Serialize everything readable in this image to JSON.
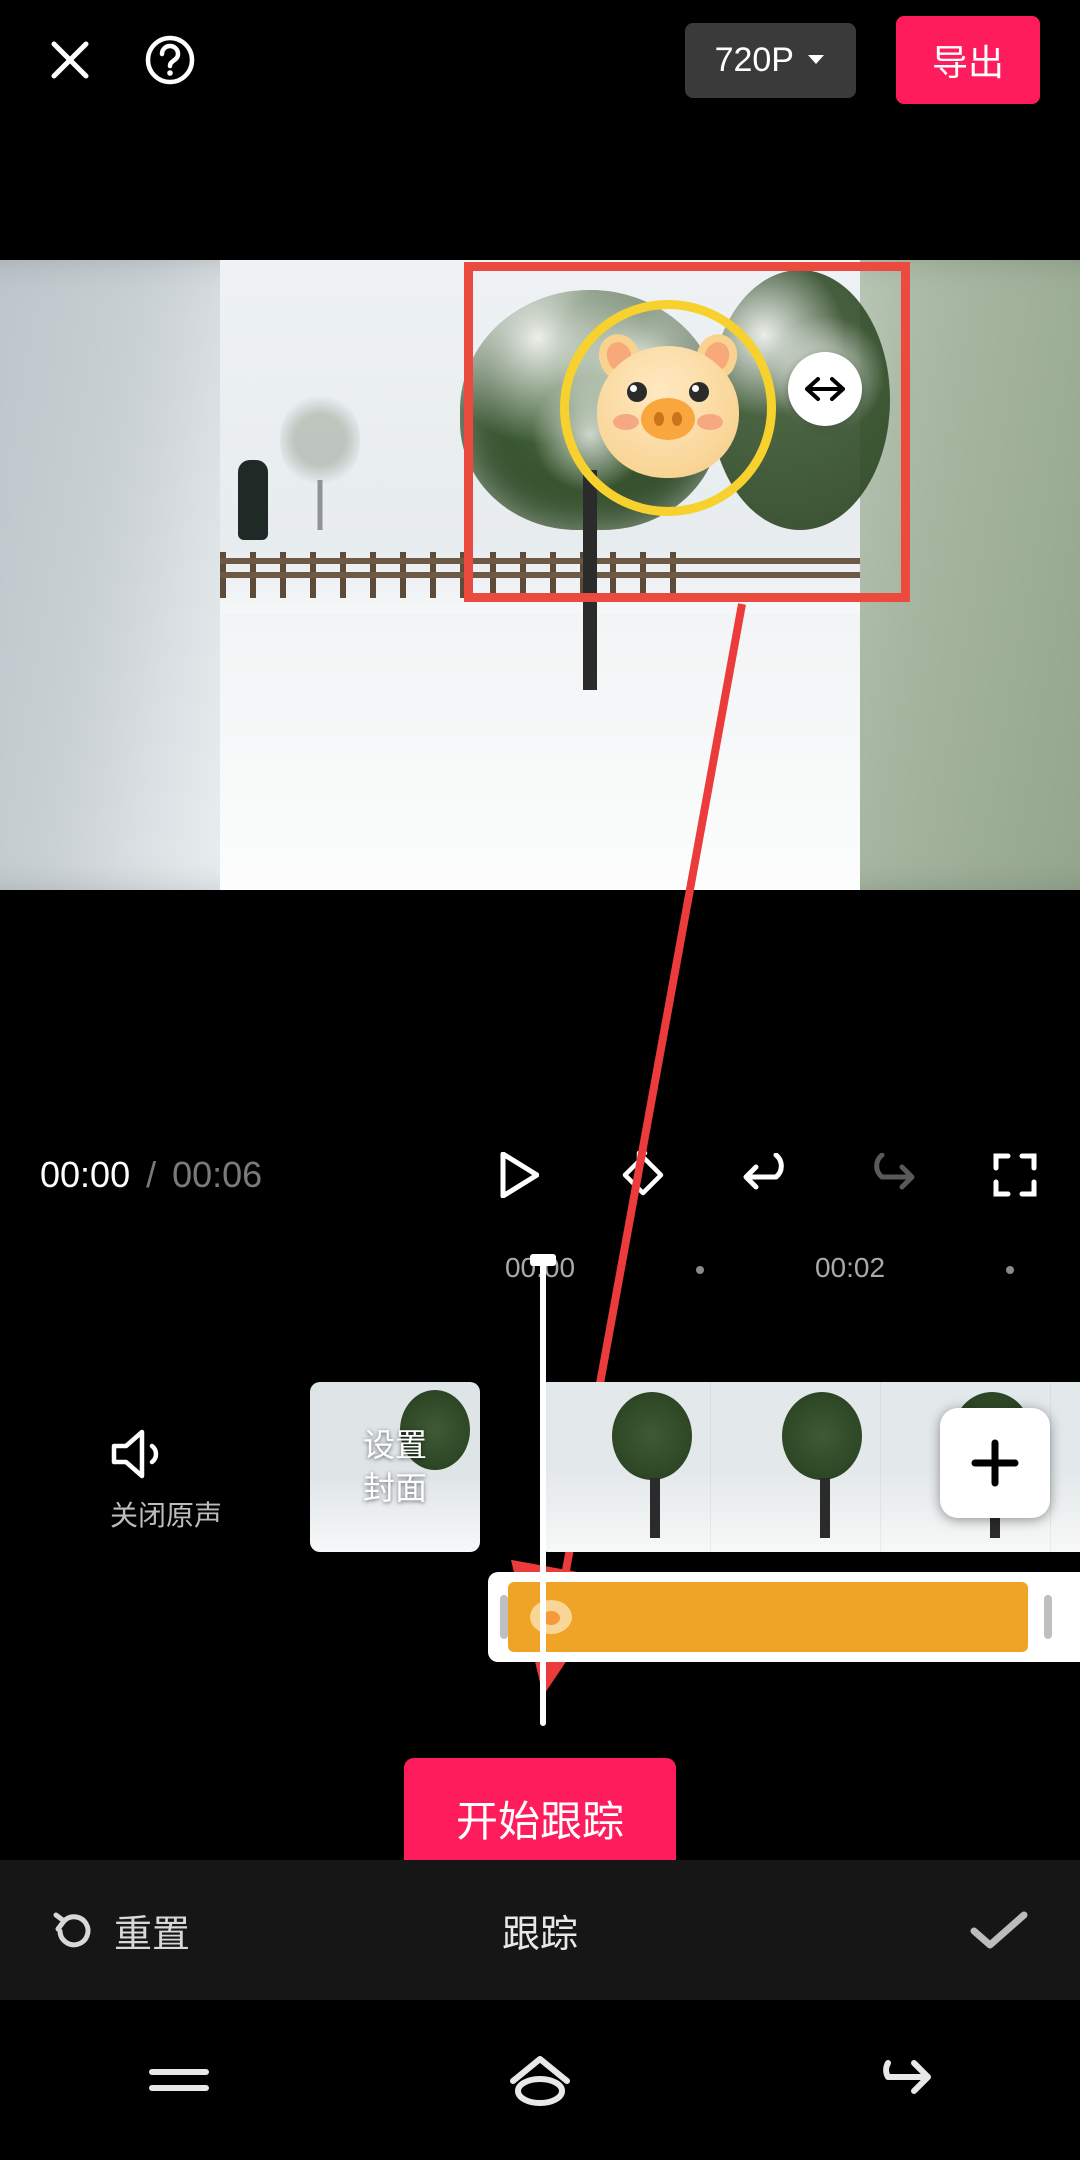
{
  "header": {
    "resolution_label": "720P",
    "export_label": "导出"
  },
  "playback": {
    "current_time": "00:00",
    "separator": "/",
    "duration": "00:06"
  },
  "ruler": {
    "t0": "00:00",
    "t1": "00:02"
  },
  "timeline": {
    "mute_label": "关闭原声",
    "cover_label": "设置\n封面"
  },
  "action": {
    "start_tracking": "开始跟踪"
  },
  "panel": {
    "reset_label": "重置",
    "title": "跟踪"
  }
}
